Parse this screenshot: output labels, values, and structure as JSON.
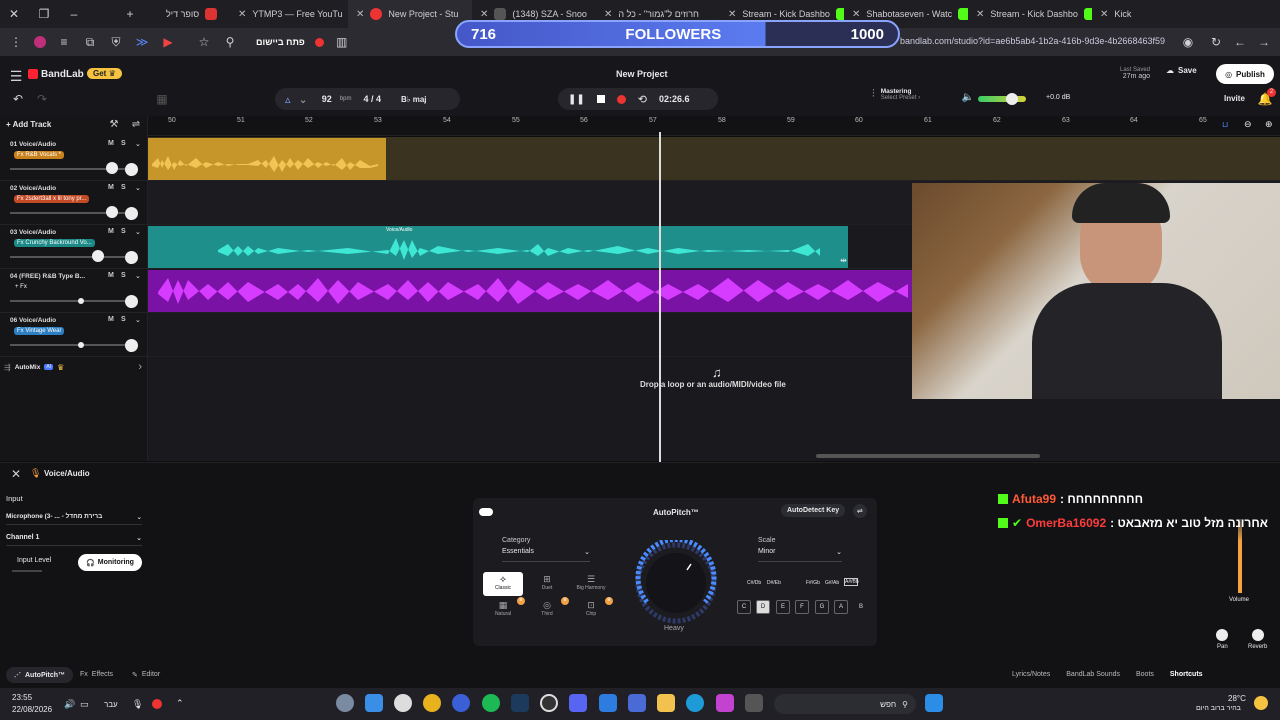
{
  "browser": {
    "tabs": [
      {
        "label": "סופר דיל",
        "active": false
      },
      {
        "label": "YTMP3 — Free YouTu",
        "active": false
      },
      {
        "label": "New Project - Stu",
        "active": true
      },
      {
        "label": "(1348) SZA - Snoo",
        "active": false
      },
      {
        "label": "חרוזים ל\"גמור\" - כל ה",
        "active": false
      },
      {
        "label": "Stream - Kick Dashbo",
        "active": false
      },
      {
        "label": "Shabotaseven - Watc",
        "active": false
      },
      {
        "label": "Stream - Kick Dashbo",
        "active": false
      },
      {
        "label": "Kick",
        "active": false
      }
    ],
    "bookmark_label": "פתח ביישום",
    "url": "bandlab.com/studio?id=ae6b5ab4-1b2a-416b-9d3e-4b2668463f59"
  },
  "overlay": {
    "followers_current": "716",
    "followers_label": "FOLLOWERS",
    "followers_goal": "1000",
    "progress": 0.7
  },
  "app": {
    "logo": "BandLab",
    "get_label": "Get",
    "project_title": "New Project",
    "last_saved_label": "Last Saved",
    "last_saved_ago": "27m ago",
    "save_label": "Save",
    "publish_label": "Publish",
    "invite_label": "Invite",
    "notification_count": "2",
    "bpm_value": "92",
    "bpm_unit": "bpm",
    "time_signature": "4 / 4",
    "key": "B♭ maj",
    "time_display": "02:26.6",
    "mastering_label": "Mastering",
    "mastering_preset": "Select Preset ›",
    "master_db": "+0.0 dB",
    "add_track_label": "Add Track"
  },
  "ruler": [
    "50",
    "51",
    "52",
    "53",
    "54",
    "55",
    "56",
    "57",
    "58",
    "59",
    "60",
    "61",
    "62",
    "63",
    "64",
    "65"
  ],
  "tracks": [
    {
      "name": "01 Voice/Audio",
      "fx": "Fx R&B Vocals *",
      "fx_color": "#c9811c"
    },
    {
      "name": "02 Voice/Audio",
      "fx": "Fx 2sdert3all x lil tony pr...",
      "fx_color": "#c34a24"
    },
    {
      "name": "03 Voice/Audio",
      "fx": "Fx Crunchy Backround Vo...",
      "fx_color": "#1c8a86"
    },
    {
      "name": "04 (FREE) R&B Type B...",
      "fx": "+ Fx",
      "fx_color": "#2a2a30"
    },
    {
      "name": "06 Voice/Audio",
      "fx": "Fx Vintage Wear",
      "fx_color": "#2d7fc2"
    }
  ],
  "clips": {
    "voice_clip_label": "Voice/Audio"
  },
  "automix_label": "AutoMix",
  "automix_badge": "AI",
  "drop_hint": "Drop a loop or an audio/MIDI/video file",
  "bottom": {
    "track_title": "Voice/Audio",
    "input_label": "Input",
    "input_device": "Microphone (3- ... - ברירת מחדל",
    "channel": "Channel 1",
    "input_level_label": "Input Level",
    "monitoring_label": "Monitoring",
    "autopitch_title": "AutoPitch™",
    "autodetect_label": "AutoDetect Key",
    "category_label": "Category",
    "category_value": "Essentials",
    "scale_label": "Scale",
    "scale_value": "Minor",
    "presets": [
      "Classic",
      "Duet",
      "Big Harmony",
      "Natural",
      "Third",
      "Chip"
    ],
    "knob_label": "Heavy",
    "sharps": [
      "C#/Db",
      "D#/Eb",
      "F#/Gb",
      "G#/Ab",
      "A#/Bb"
    ],
    "notes": [
      "C",
      "D",
      "E",
      "F",
      "G",
      "A",
      "B"
    ],
    "volume_label": "Volume",
    "pan_label": "Pan",
    "reverb_label": "Reverb",
    "tabs": [
      "AutoPitch™",
      "Effects",
      "Editor"
    ],
    "right_links": [
      "Lyrics/Notes",
      "BandLab Sounds",
      "Boots",
      "Shortcuts"
    ]
  },
  "chat": [
    {
      "user": "Afuta99",
      "msg": ": חחחחחחחחח"
    },
    {
      "user": "OmerBa16092",
      "msg": ": אחרונה מזל טוב יא מזאבאט"
    }
  ],
  "taskbar": {
    "time": "23:55",
    "date": "22/08/2026",
    "lang": "עבר",
    "search": "חפש",
    "weather_temp": "28°C",
    "weather_desc": "בהיר ברוב היום"
  }
}
